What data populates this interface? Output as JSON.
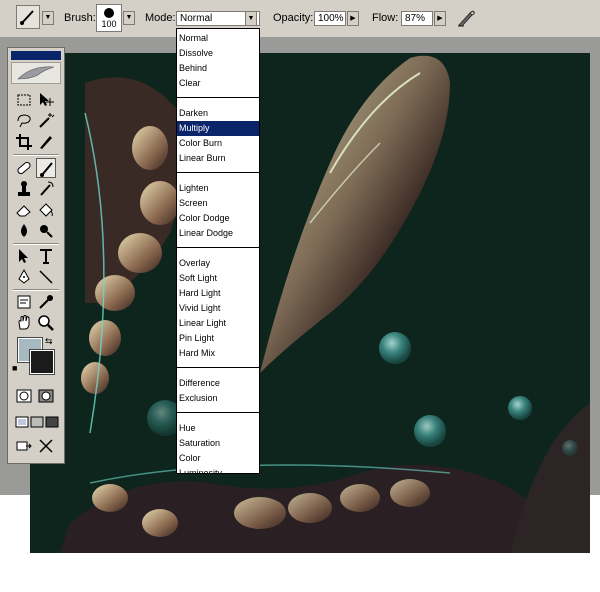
{
  "options_bar": {
    "brush_label": "Brush:",
    "brush_size": "100",
    "mode_label": "Mode:",
    "mode_value": "Normal",
    "opacity_label": "Opacity:",
    "opacity_value": "100%",
    "flow_label": "Flow:",
    "flow_value": "87%"
  },
  "blend_modes": [
    "Normal",
    "Dissolve",
    "Behind",
    "Clear",
    "Darken",
    "Multiply",
    "Color Burn",
    "Linear Burn",
    "Lighten",
    "Screen",
    "Color Dodge",
    "Linear Dodge",
    "Overlay",
    "Soft Light",
    "Hard Light",
    "Vivid Light",
    "Linear Light",
    "Pin Light",
    "Hard Mix",
    "Difference",
    "Exclusion",
    "Hue",
    "Saturation",
    "Color",
    "Luminosity"
  ],
  "highlighted_mode": "Multiply",
  "colors": {
    "ui_face": "#d4d0c8",
    "highlight": "#0a246a",
    "foreground": "#a6b8c0",
    "background": "#1b1b1b",
    "canvas_bg": "#0f2a20"
  },
  "toolbox": {
    "tools": [
      "marquee-icon",
      "move-icon",
      "lasso-icon",
      "magic-wand-icon",
      "crop-icon",
      "slice-icon",
      "healing-brush-icon",
      "brush-icon",
      "clone-stamp-icon",
      "history-brush-icon",
      "eraser-icon",
      "paint-bucket-icon",
      "blur-icon",
      "dodge-icon",
      "path-select-icon",
      "type-icon",
      "pen-icon",
      "line-icon",
      "notes-icon",
      "eyedropper-icon",
      "hand-icon",
      "zoom-icon"
    ],
    "selected_tool": "brush-icon"
  }
}
